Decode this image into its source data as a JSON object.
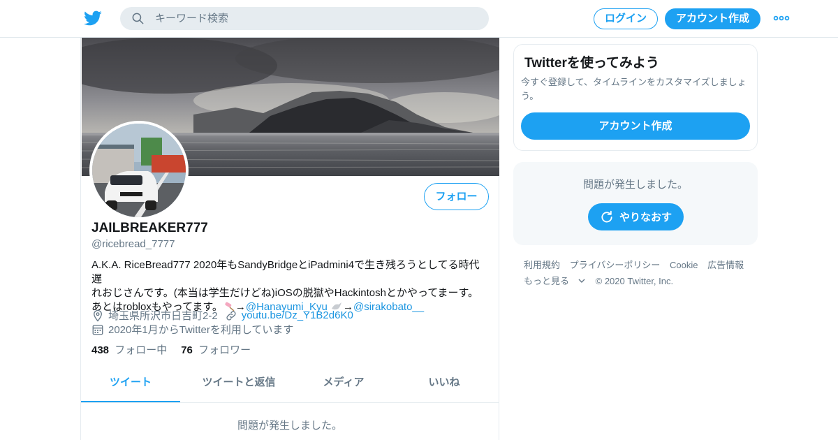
{
  "colors": {
    "accent": "#1da1f2",
    "link": "#1b95e0",
    "muted": "#657786",
    "text": "#14171a"
  },
  "header": {
    "search_placeholder": "キーワード検索",
    "login_label": "ログイン",
    "signup_label": "アカウント作成"
  },
  "profile": {
    "name": "JAILBREAKER777",
    "handle": "@ricebread_7777",
    "follow_label": "フォロー",
    "bio_line1": "A.K.A. RiceBread777 2020年もSandyBridgeとiPadmini4で生き残ろうとしてる時代遅",
    "bio_line2": "れおじさんです。(本当は学生だけどね)iOSの脱獄やHackintoshとかやってまーす。",
    "bio_line3_prefix": "あとはrobloxもやってます。",
    "arrow": "→",
    "mention1": "@Hanayumi_Kyu",
    "mention2": "@sirakobato__",
    "location": "埼玉県所沢市日吉町2-2",
    "url": "youtu.be/Dz_Y1B2d6K0",
    "joined": "2020年1月からTwitterを利用しています",
    "following_count": "438",
    "following_label": "フォロー中",
    "followers_count": "76",
    "followers_label": "フォロワー"
  },
  "tabs": [
    {
      "label": "ツイート",
      "active": true
    },
    {
      "label": "ツイートと返信"
    },
    {
      "label": "メディア"
    },
    {
      "label": "いいね"
    }
  ],
  "timeline": {
    "error_text": "問題が発生しました。"
  },
  "sidebar": {
    "signup_card": {
      "title": "Twitterを使ってみよう",
      "description": "今すぐ登録して、タイムラインをカスタマイズしましょう。",
      "cta": "アカウント作成"
    },
    "error_card": {
      "text": "問題が発生しました。",
      "retry": "やりなおす"
    },
    "footer": {
      "links": [
        "利用規約",
        "プライバシーポリシー",
        "Cookie",
        "広告情報"
      ],
      "more": "もっと見る",
      "copyright": "© 2020 Twitter, Inc."
    }
  },
  "icons": [
    "twitter-bird-icon",
    "search-icon",
    "more-dots-icon",
    "location-pin-icon",
    "link-icon",
    "calendar-icon",
    "refresh-icon",
    "chevron-down-icon"
  ]
}
